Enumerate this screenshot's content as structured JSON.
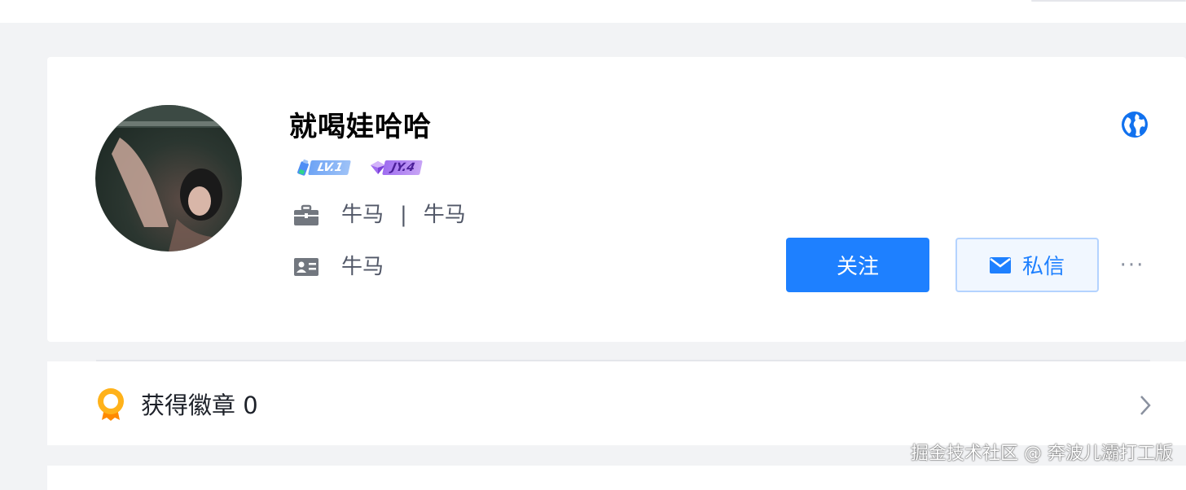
{
  "profile": {
    "username": "就喝娃哈哈",
    "level_badge": "LV.1",
    "jy_badge": "JY.4",
    "job_title": "牛马",
    "separator": "|",
    "company": "牛马",
    "intro": "牛马"
  },
  "actions": {
    "follow_label": "关注",
    "message_label": "私信",
    "more_label": "···"
  },
  "badges_section": {
    "title": "获得徽章 0"
  },
  "watermark": "掘金技术社区 @ 奔波儿灞打工版",
  "colors": {
    "accent": "#1e80ff",
    "page_background": "#f2f3f5",
    "medal": "#ffb21a"
  },
  "icons": [
    "briefcase-icon",
    "id-card-icon",
    "globe-icon",
    "mail-icon",
    "more-icon",
    "medal-icon",
    "chevron-right-icon"
  ]
}
